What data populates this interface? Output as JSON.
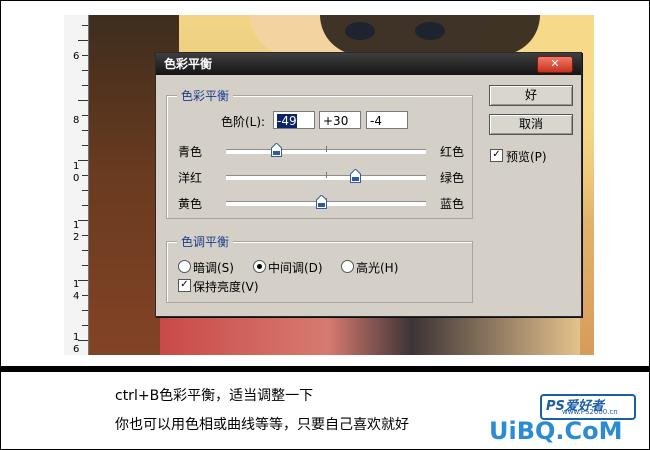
{
  "dialog": {
    "title": "色彩平衡",
    "close_label": "✕",
    "color_balance": {
      "group_label": "色彩平衡",
      "levels_label": "色阶(L):",
      "levels": [
        "-49",
        "+30",
        "-4"
      ],
      "sliders": [
        {
          "left": "青色",
          "right": "红色",
          "value": -49
        },
        {
          "left": "洋红",
          "right": "绿色",
          "value": 30
        },
        {
          "left": "黄色",
          "right": "蓝色",
          "value": -4
        }
      ]
    },
    "tone_balance": {
      "group_label": "色调平衡",
      "shadows": "暗调(S)",
      "midtones": "中间调(D)",
      "highlights": "高光(H)",
      "selected": "midtones",
      "preserve_luminosity": "保持亮度(V)",
      "preserve_checked": true
    },
    "ok_label": "好",
    "cancel_label": "取消",
    "preview_label": "预览(P)",
    "preview_checked": true
  },
  "ruler": {
    "labels": [
      "6",
      "8",
      "1",
      "0",
      "1",
      "2",
      "1",
      "4",
      "1",
      "6"
    ]
  },
  "caption": {
    "line1": "ctrl+B色彩平衡，适当调整一下",
    "line2": "你也可以用色相或曲线等等，只要自己喜欢就好"
  },
  "watermark": {
    "logo_big": "PS爱好者",
    "logo_small": "www.PS2000.cn",
    "site": "UiBQ.CoM"
  },
  "colors": {
    "accent_label": "#1c3c8c",
    "uibq": "#2b8bd3"
  }
}
